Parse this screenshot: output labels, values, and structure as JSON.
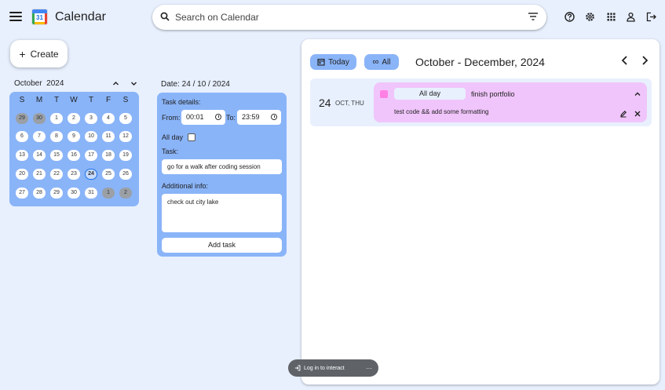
{
  "header": {
    "title": "Calendar",
    "logo_number": "31",
    "search_placeholder": "Search on Calendar"
  },
  "icons": [
    "menu-icon",
    "search-icon",
    "filter-icon",
    "help-icon",
    "settings-icon",
    "apps-icon",
    "account-icon",
    "logout-icon"
  ],
  "sidebar": {
    "create_label": "Create",
    "mini_calendar": {
      "month": "October",
      "year": "2024",
      "weekdays": [
        "S",
        "M",
        "T",
        "W",
        "T",
        "F",
        "S"
      ],
      "weeks": [
        [
          "29",
          "30",
          "1",
          "2",
          "3",
          "4",
          "5"
        ],
        [
          "6",
          "7",
          "8",
          "9",
          "10",
          "11",
          "12"
        ],
        [
          "13",
          "14",
          "15",
          "16",
          "17",
          "18",
          "19"
        ],
        [
          "20",
          "21",
          "22",
          "23",
          "24",
          "25",
          "26"
        ],
        [
          "27",
          "28",
          "29",
          "30",
          "31",
          "1",
          "2"
        ]
      ],
      "today": "24"
    }
  },
  "task_form": {
    "date_label": "Date: 24 / 10 / 2024",
    "details_label": "Task details:",
    "from_label": "From:",
    "from_value": "00:01",
    "to_label": "To:",
    "to_value": "23:59",
    "all_day_label": "All day",
    "all_day_checked": false,
    "task_label": "Task:",
    "task_value": "go for a walk after coding session",
    "info_label": "Additional info:",
    "info_value": "check out city lake",
    "add_button": "Add task"
  },
  "main": {
    "today_button": "Today",
    "all_button": "All",
    "range_title": "October - December, 2024",
    "events": [
      {
        "day": "24",
        "dow": "OCT, THU",
        "all_day_label": "All day",
        "title": "finish portfolio",
        "description": "test code && add some formatting",
        "color": "#ff7fe5"
      }
    ]
  },
  "toast": {
    "label": "Log in to interact",
    "more": "···"
  },
  "colors": {
    "background": "#e8f0fe",
    "accent": "#8ab4f8",
    "event_card": "#f0c5fb",
    "event_swatch": "#ff7fe5"
  }
}
